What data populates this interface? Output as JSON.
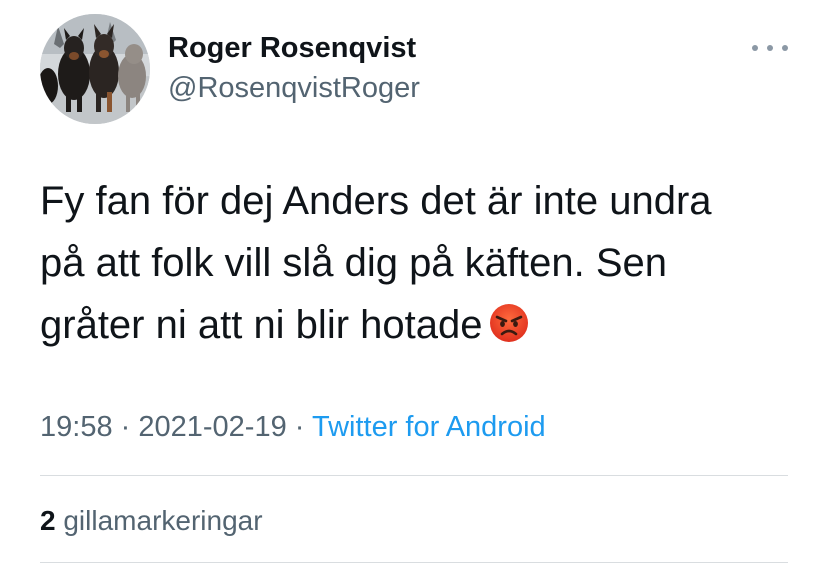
{
  "author": {
    "name": "Roger Rosenqvist",
    "handle": "@RosenqvistRoger"
  },
  "tweet": {
    "lines": [
      "Fy fan för dej Anders  det är inte undra",
      "på att folk vill slå dig på käften. Sen",
      "gråter ni att ni blir hotade"
    ],
    "emoji": "angry-face"
  },
  "meta": {
    "time": "19:58",
    "separator": " · ",
    "date": "2021-02-19",
    "source": "Twitter for Android"
  },
  "stats": {
    "likes_count": "2",
    "likes_label": "gillamarkeringar"
  },
  "colors": {
    "text": "#0f1419",
    "secondary": "#536471",
    "link": "#1d9bf0",
    "divider": "#d9dde0"
  }
}
